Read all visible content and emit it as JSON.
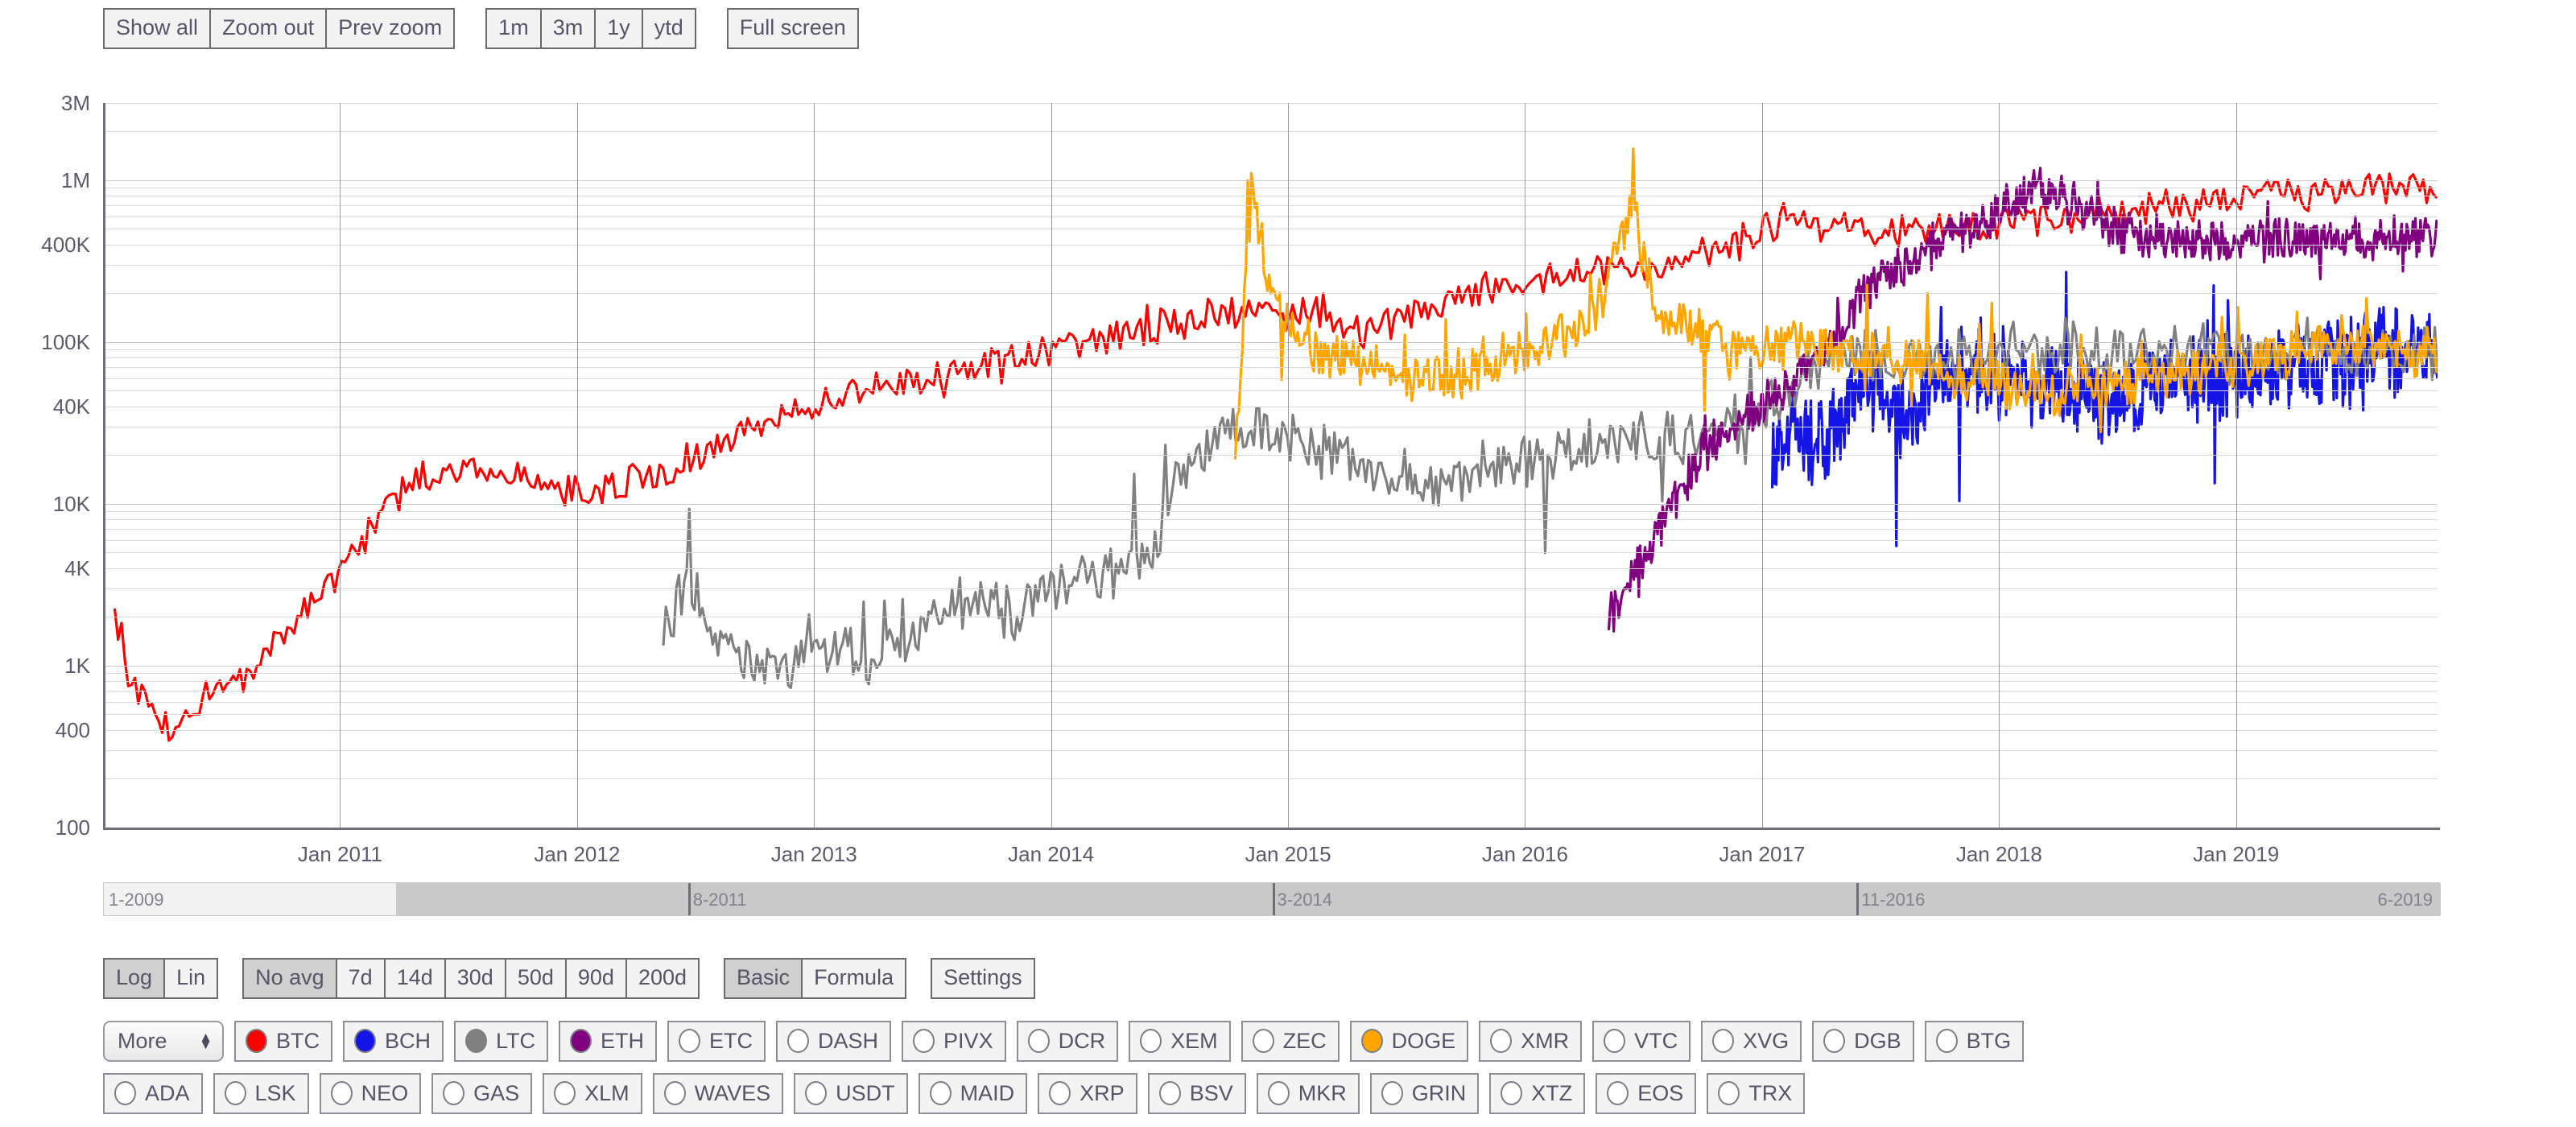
{
  "toolbar": {
    "zoom_group": [
      "Show all",
      "Zoom out",
      "Prev zoom"
    ],
    "range_group": [
      "1m",
      "3m",
      "1y",
      "ytd"
    ],
    "fullscreen": "Full screen"
  },
  "chart_data": {
    "type": "line",
    "title": "",
    "xlabel": "",
    "ylabel": "",
    "scale": "log",
    "ylim": [
      100,
      3000000
    ],
    "y_ticks": [
      "3M",
      "1M",
      "400K",
      "100K",
      "40K",
      "10K",
      "4K",
      "1K",
      "400",
      "100"
    ],
    "y_tick_values": [
      3000000,
      1000000,
      400000,
      100000,
      40000,
      10000,
      4000,
      1000,
      400,
      100
    ],
    "x_ticks": [
      "Jan 2011",
      "Jan 2012",
      "Jan 2013",
      "Jan 2014",
      "Jan 2015",
      "Jan 2016",
      "Jan 2017",
      "Jan 2018",
      "Jan 2019"
    ],
    "x_range": [
      "1-2009",
      "6-2019"
    ],
    "grid": true,
    "legend_position": "bottom",
    "series": [
      {
        "name": "BTC",
        "color": "#ff0000",
        "start_x": 0.005,
        "noise": 0.16,
        "spike": 0.1,
        "points": [
          [
            0.005,
            2500
          ],
          [
            0.012,
            700
          ],
          [
            0.02,
            500
          ],
          [
            0.03,
            420
          ],
          [
            0.045,
            700
          ],
          [
            0.06,
            900
          ],
          [
            0.075,
            1400
          ],
          [
            0.09,
            2600
          ],
          [
            0.105,
            4500
          ],
          [
            0.12,
            9000
          ],
          [
            0.135,
            14000
          ],
          [
            0.15,
            17000
          ],
          [
            0.165,
            16000
          ],
          [
            0.18,
            14000
          ],
          [
            0.195,
            12000
          ],
          [
            0.21,
            11000
          ],
          [
            0.225,
            13000
          ],
          [
            0.24,
            16000
          ],
          [
            0.26,
            22000
          ],
          [
            0.28,
            30000
          ],
          [
            0.3,
            40000
          ],
          [
            0.32,
            48000
          ],
          [
            0.34,
            55000
          ],
          [
            0.36,
            62000
          ],
          [
            0.38,
            70000
          ],
          [
            0.4,
            85000
          ],
          [
            0.42,
            95000
          ],
          [
            0.44,
            110000
          ],
          [
            0.46,
            130000
          ],
          [
            0.48,
            150000
          ],
          [
            0.5,
            160000
          ],
          [
            0.52,
            140000
          ],
          [
            0.54,
            120000
          ],
          [
            0.56,
            150000
          ],
          [
            0.58,
            200000
          ],
          [
            0.6,
            230000
          ],
          [
            0.62,
            250000
          ],
          [
            0.64,
            260000
          ],
          [
            0.66,
            280000
          ],
          [
            0.68,
            320000
          ],
          [
            0.7,
            400000
          ],
          [
            0.72,
            600000
          ],
          [
            0.74,
            520000
          ],
          [
            0.76,
            480000
          ],
          [
            0.78,
            500000
          ],
          [
            0.8,
            520000
          ],
          [
            0.82,
            560000
          ],
          [
            0.84,
            600000
          ],
          [
            0.86,
            640000
          ],
          [
            0.88,
            700000
          ],
          [
            0.9,
            740000
          ],
          [
            0.92,
            780000
          ],
          [
            0.94,
            820000
          ],
          [
            0.96,
            860000
          ],
          [
            0.98,
            880000
          ],
          [
            1.0,
            900000
          ],
          [
            1.02,
            880000
          ]
        ]
      },
      {
        "name": "BCH",
        "color": "#1414e6",
        "start_x": 0.715,
        "noise": 0.42,
        "spike": 0.55,
        "points": [
          [
            0.715,
            20000
          ],
          [
            0.725,
            30000
          ],
          [
            0.735,
            22000
          ],
          [
            0.745,
            35000
          ],
          [
            0.755,
            60000
          ],
          [
            0.765,
            40000
          ],
          [
            0.775,
            35000
          ],
          [
            0.785,
            55000
          ],
          [
            0.8,
            70000
          ],
          [
            0.82,
            60000
          ],
          [
            0.84,
            50000
          ],
          [
            0.86,
            45000
          ],
          [
            0.88,
            55000
          ],
          [
            0.9,
            60000
          ],
          [
            0.92,
            65000
          ],
          [
            0.94,
            70000
          ],
          [
            0.96,
            75000
          ],
          [
            0.98,
            85000
          ],
          [
            1.0,
            90000
          ],
          [
            1.02,
            95000
          ]
        ]
      },
      {
        "name": "LTC",
        "color": "#808080",
        "start_x": 0.24,
        "noise": 0.26,
        "spike": 0.4,
        "points": [
          [
            0.24,
            1500
          ],
          [
            0.25,
            3500
          ],
          [
            0.26,
            1800
          ],
          [
            0.27,
            1200
          ],
          [
            0.285,
            900
          ],
          [
            0.3,
            1100
          ],
          [
            0.315,
            1300
          ],
          [
            0.33,
            1000
          ],
          [
            0.345,
            1500
          ],
          [
            0.36,
            2200
          ],
          [
            0.375,
            2600
          ],
          [
            0.39,
            2200
          ],
          [
            0.405,
            2800
          ],
          [
            0.42,
            3500
          ],
          [
            0.435,
            4000
          ],
          [
            0.45,
            6000
          ],
          [
            0.465,
            20000
          ],
          [
            0.48,
            28000
          ],
          [
            0.495,
            30000
          ],
          [
            0.51,
            25000
          ],
          [
            0.525,
            20000
          ],
          [
            0.54,
            17000
          ],
          [
            0.555,
            14000
          ],
          [
            0.57,
            13000
          ],
          [
            0.585,
            15000
          ],
          [
            0.6,
            17000
          ],
          [
            0.62,
            20000
          ],
          [
            0.64,
            22000
          ],
          [
            0.66,
            25000
          ],
          [
            0.68,
            26000
          ],
          [
            0.7,
            30000
          ],
          [
            0.72,
            45000
          ],
          [
            0.74,
            90000
          ],
          [
            0.76,
            80000
          ],
          [
            0.78,
            75000
          ],
          [
            0.8,
            80000
          ],
          [
            0.82,
            85000
          ],
          [
            0.84,
            90000
          ],
          [
            0.86,
            85000
          ],
          [
            0.88,
            88000
          ],
          [
            0.92,
            90000
          ],
          [
            0.96,
            88000
          ],
          [
            1.0,
            85000
          ],
          [
            1.02,
            84000
          ]
        ]
      },
      {
        "name": "ETH",
        "color": "#800080",
        "start_x": 0.645,
        "noise": 0.2,
        "spike": 0.18,
        "points": [
          [
            0.645,
            2000
          ],
          [
            0.655,
            3500
          ],
          [
            0.665,
            6000
          ],
          [
            0.675,
            12000
          ],
          [
            0.685,
            20000
          ],
          [
            0.695,
            28000
          ],
          [
            0.705,
            35000
          ],
          [
            0.715,
            45000
          ],
          [
            0.725,
            60000
          ],
          [
            0.735,
            90000
          ],
          [
            0.745,
            130000
          ],
          [
            0.755,
            200000
          ],
          [
            0.765,
            280000
          ],
          [
            0.775,
            320000
          ],
          [
            0.785,
            400000
          ],
          [
            0.8,
            500000
          ],
          [
            0.815,
            700000
          ],
          [
            0.83,
            900000
          ],
          [
            0.845,
            700000
          ],
          [
            0.86,
            500000
          ],
          [
            0.88,
            430000
          ],
          [
            0.9,
            400000
          ],
          [
            0.92,
            420000
          ],
          [
            0.94,
            450000
          ],
          [
            0.96,
            430000
          ],
          [
            0.98,
            420000
          ],
          [
            1.0,
            440000
          ],
          [
            1.02,
            430000
          ]
        ]
      },
      {
        "name": "DOGE",
        "color": "#ffa500",
        "start_x": 0.485,
        "noise": 0.22,
        "spike": 0.35,
        "points": [
          [
            0.485,
            20000
          ],
          [
            0.492,
            900000
          ],
          [
            0.5,
            200000
          ],
          [
            0.51,
            120000
          ],
          [
            0.52,
            90000
          ],
          [
            0.535,
            80000
          ],
          [
            0.55,
            70000
          ],
          [
            0.565,
            60000
          ],
          [
            0.58,
            65000
          ],
          [
            0.595,
            75000
          ],
          [
            0.61,
            90000
          ],
          [
            0.625,
            110000
          ],
          [
            0.64,
            150000
          ],
          [
            0.655,
            700000
          ],
          [
            0.665,
            180000
          ],
          [
            0.68,
            120000
          ],
          [
            0.7,
            100000
          ],
          [
            0.72,
            95000
          ],
          [
            0.74,
            90000
          ],
          [
            0.76,
            80000
          ],
          [
            0.78,
            70000
          ],
          [
            0.8,
            60000
          ],
          [
            0.82,
            55000
          ],
          [
            0.84,
            50000
          ],
          [
            0.86,
            55000
          ],
          [
            0.88,
            60000
          ],
          [
            0.9,
            65000
          ],
          [
            0.92,
            75000
          ],
          [
            0.94,
            85000
          ],
          [
            0.96,
            95000
          ],
          [
            0.98,
            90000
          ],
          [
            1.0,
            88000
          ],
          [
            1.02,
            90000
          ]
        ]
      }
    ]
  },
  "navigator": {
    "labels": [
      "1-2009",
      "8-2011",
      "3-2014",
      "11-2016",
      "6-2019"
    ],
    "selection_start_pct": 12.5,
    "selection_end_pct": 100
  },
  "controls": {
    "scale_group": [
      "Log",
      "Lin"
    ],
    "scale_selected": "Log",
    "avg_group": [
      "No avg",
      "7d",
      "14d",
      "30d",
      "50d",
      "90d",
      "200d"
    ],
    "avg_selected": "No avg",
    "mode_group": [
      "Basic",
      "Formula"
    ],
    "mode_selected": "Basic",
    "settings": "Settings"
  },
  "coins": {
    "more_label": "More",
    "row1": [
      {
        "ticker": "BTC",
        "color": "#ff0000",
        "active": true
      },
      {
        "ticker": "BCH",
        "color": "#1414e6",
        "active": true
      },
      {
        "ticker": "LTC",
        "color": "#808080",
        "active": true
      },
      {
        "ticker": "ETH",
        "color": "#800080",
        "active": true
      },
      {
        "ticker": "ETC",
        "color": "",
        "active": false
      },
      {
        "ticker": "DASH",
        "color": "",
        "active": false
      },
      {
        "ticker": "PIVX",
        "color": "",
        "active": false
      },
      {
        "ticker": "DCR",
        "color": "",
        "active": false
      },
      {
        "ticker": "XEM",
        "color": "",
        "active": false
      },
      {
        "ticker": "ZEC",
        "color": "",
        "active": false
      },
      {
        "ticker": "DOGE",
        "color": "#ffa500",
        "active": true
      },
      {
        "ticker": "XMR",
        "color": "",
        "active": false
      },
      {
        "ticker": "VTC",
        "color": "",
        "active": false
      },
      {
        "ticker": "XVG",
        "color": "",
        "active": false
      },
      {
        "ticker": "DGB",
        "color": "",
        "active": false
      },
      {
        "ticker": "BTG",
        "color": "",
        "active": false
      }
    ],
    "row2": [
      {
        "ticker": "ADA",
        "color": "",
        "active": false
      },
      {
        "ticker": "LSK",
        "color": "",
        "active": false
      },
      {
        "ticker": "NEO",
        "color": "",
        "active": false
      },
      {
        "ticker": "GAS",
        "color": "",
        "active": false
      },
      {
        "ticker": "XLM",
        "color": "",
        "active": false
      },
      {
        "ticker": "WAVES",
        "color": "",
        "active": false
      },
      {
        "ticker": "USDT",
        "color": "",
        "active": false
      },
      {
        "ticker": "MAID",
        "color": "",
        "active": false
      },
      {
        "ticker": "XRP",
        "color": "",
        "active": false
      },
      {
        "ticker": "BSV",
        "color": "",
        "active": false
      },
      {
        "ticker": "MKR",
        "color": "",
        "active": false
      },
      {
        "ticker": "GRIN",
        "color": "",
        "active": false
      },
      {
        "ticker": "XTZ",
        "color": "",
        "active": false
      },
      {
        "ticker": "EOS",
        "color": "",
        "active": false
      },
      {
        "ticker": "TRX",
        "color": "",
        "active": false
      }
    ]
  }
}
